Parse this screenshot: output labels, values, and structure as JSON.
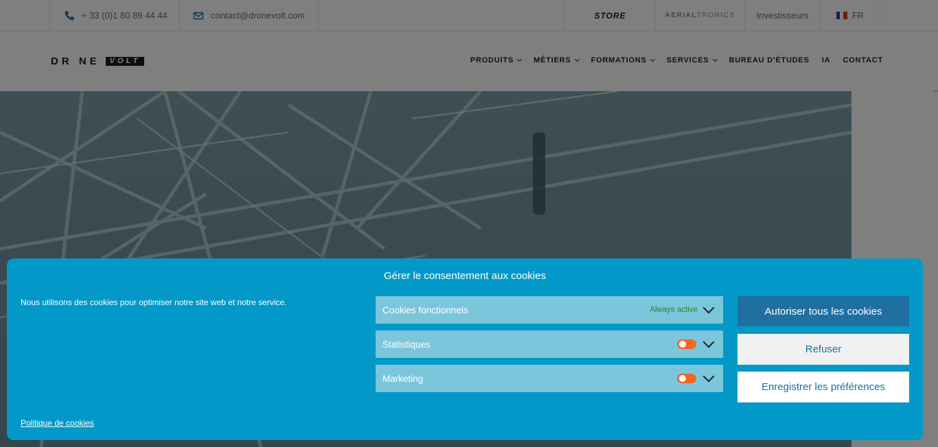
{
  "topbar": {
    "phone": "+ 33 (0)1 80 89 44 44",
    "email": "contact@dronevolt.com",
    "store": "STORE",
    "aerial_a": "AERIAL",
    "aerial_b": "TRONICS",
    "investors": "Investisseurs",
    "lang": "FR"
  },
  "logo": {
    "drone": "DR NE",
    "volt": "VOLT"
  },
  "nav": {
    "items": [
      {
        "label": "PRODUITS",
        "dropdown": true
      },
      {
        "label": "MÉTIERS",
        "dropdown": true
      },
      {
        "label": "FORMATIONS",
        "dropdown": true
      },
      {
        "label": "SERVICES",
        "dropdown": true
      },
      {
        "label": "BUREAU D'ÉTUDES",
        "dropdown": false
      },
      {
        "label": "IA",
        "dropdown": false
      },
      {
        "label": "CONTACT",
        "dropdown": false
      }
    ]
  },
  "cookie": {
    "title": "Gérer le consentement aux cookies",
    "message": "Nous utilisons des cookies pour optimiser notre site web et notre service.",
    "policy_link": "Politique de cookies",
    "categories": [
      {
        "label": "Cookies fonctionnels",
        "status": "Always active"
      },
      {
        "label": "Statistiques",
        "status": ""
      },
      {
        "label": "Marketing",
        "status": ""
      }
    ],
    "buttons": {
      "accept": "Autoriser tous les cookies",
      "deny": "Refuser",
      "save": "Enregistrer les préférences"
    }
  },
  "colors": {
    "banner_bg": "#0299c8",
    "category_bg": "#7cc6dc",
    "accept_bg": "#1f6fa0",
    "toggle": "#f26722",
    "always_active": "#1d8b2a"
  }
}
